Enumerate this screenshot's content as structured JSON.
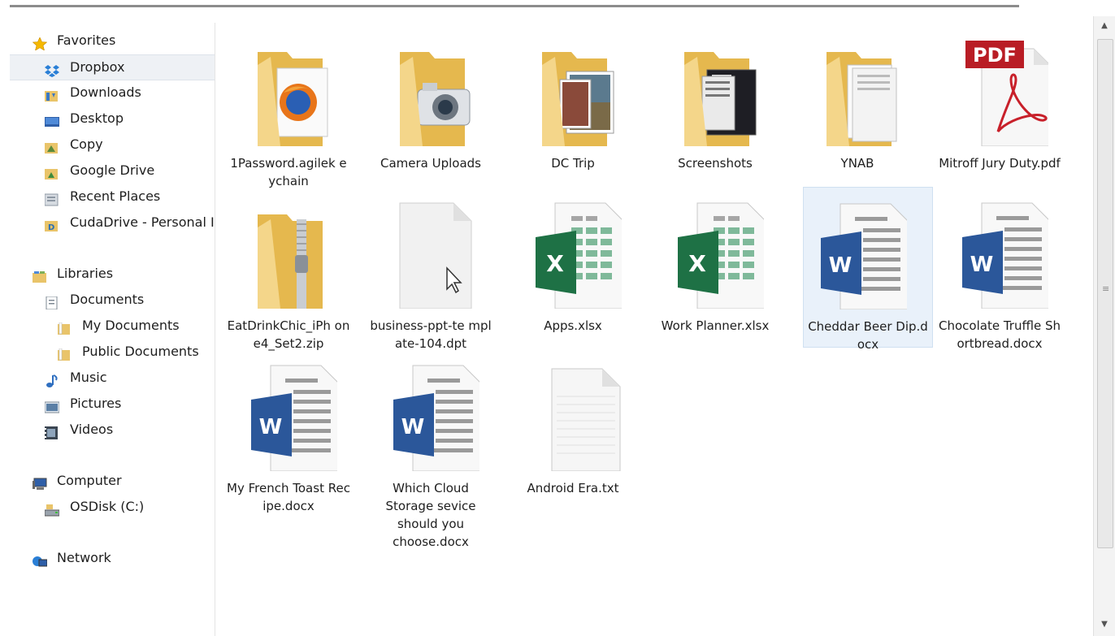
{
  "sidebar": {
    "favorites": {
      "label": "Favorites",
      "icon": "star-icon"
    },
    "favorite_items": [
      {
        "label": "Dropbox",
        "icon": "dropbox-icon",
        "selected": true
      },
      {
        "label": "Downloads",
        "icon": "downloads-folder-icon"
      },
      {
        "label": "Desktop",
        "icon": "desktop-icon"
      },
      {
        "label": "Copy",
        "icon": "copy-folder-icon"
      },
      {
        "label": "Google Drive",
        "icon": "google-drive-folder-icon"
      },
      {
        "label": "Recent Places",
        "icon": "recent-places-icon"
      },
      {
        "label": "CudaDrive - Personal I",
        "icon": "cudadrive-icon"
      }
    ],
    "libraries": {
      "label": "Libraries",
      "icon": "libraries-icon"
    },
    "library_items": [
      {
        "label": "Documents",
        "icon": "documents-icon"
      },
      {
        "label": "My Documents",
        "icon": "folder-icon"
      },
      {
        "label": "Public Documents",
        "icon": "folder-icon"
      },
      {
        "label": "Music",
        "icon": "music-icon"
      },
      {
        "label": "Pictures",
        "icon": "pictures-icon"
      },
      {
        "label": "Videos",
        "icon": "videos-icon"
      }
    ],
    "computer": {
      "label": "Computer",
      "icon": "computer-icon"
    },
    "computer_items": [
      {
        "label": "OSDisk (C:)",
        "icon": "disk-icon"
      }
    ],
    "network": {
      "label": "Network",
      "icon": "network-icon"
    }
  },
  "files": [
    {
      "name": "1Password.agilekeychain",
      "display": "1Password.agilek eychain",
      "type": "folder-firefox"
    },
    {
      "name": "Camera Uploads",
      "display": "Camera Uploads",
      "type": "folder-camera"
    },
    {
      "name": "DC Trip",
      "display": "DC Trip",
      "type": "folder-photos"
    },
    {
      "name": "Screenshots",
      "display": "Screenshots",
      "type": "folder-screens"
    },
    {
      "name": "YNAB",
      "display": "YNAB",
      "type": "folder-docs"
    },
    {
      "name": "Mitroff Jury Duty.pdf",
      "display": "Mitroff Jury Duty.pdf",
      "type": "pdf",
      "badge": "PDF"
    },
    {
      "name": "EatDrinkChic_iPhone4_Set2.zip",
      "display": "EatDrinkChic_iPh one4_Set2.zip",
      "type": "zip"
    },
    {
      "name": "business-ppt-template-104.dpt",
      "display": "business-ppt-te mplate-104.dpt",
      "type": "blank"
    },
    {
      "name": "Apps.xlsx",
      "display": "Apps.xlsx",
      "type": "excel",
      "badge": "X"
    },
    {
      "name": "Work Planner.xlsx",
      "display": "Work Planner.xlsx",
      "type": "excel",
      "badge": "X"
    },
    {
      "name": "Cheddar Beer Dip.docx",
      "display": "Cheddar Beer Dip.docx",
      "type": "word",
      "badge": "W",
      "selected": true
    },
    {
      "name": "Chocolate Truffle Shortbread.docx",
      "display": "Chocolate Truffle Shortbread.docx",
      "type": "word",
      "badge": "W"
    },
    {
      "name": "My French Toast Recipe.docx",
      "display": "My French Toast Recipe.docx",
      "type": "word",
      "badge": "W"
    },
    {
      "name": "Which Cloud Storage sevice should you choose.docx",
      "display": "Which Cloud Storage sevice should you choose.docx",
      "type": "word",
      "badge": "W"
    },
    {
      "name": "Android Era.txt",
      "display": "Android Era.txt",
      "type": "text"
    }
  ],
  "colors": {
    "folder": "#f2d37c",
    "excel": "#1e7145",
    "word": "#2b579a",
    "pdf": "#c8202a",
    "selection": "#e9f1fa"
  }
}
